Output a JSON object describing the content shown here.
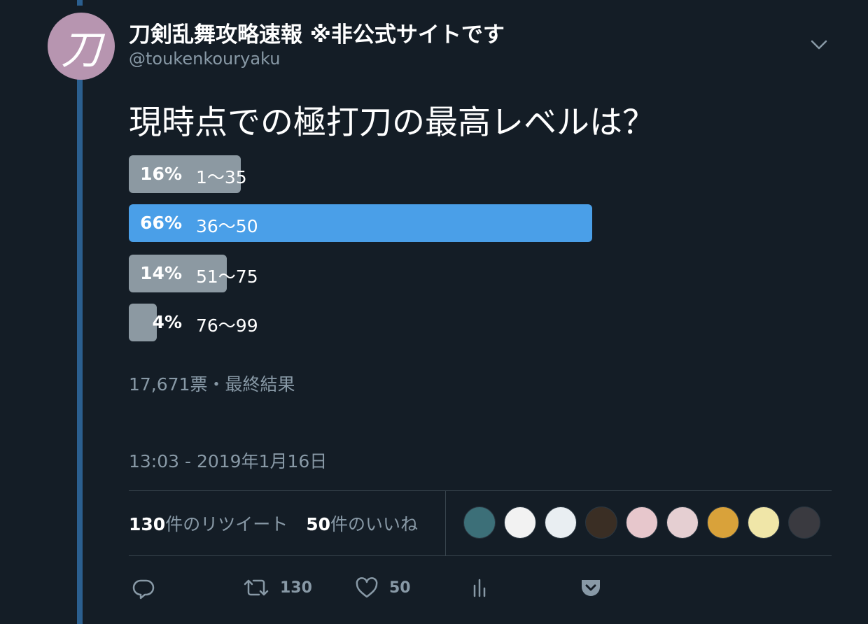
{
  "tweet": {
    "author_name": "刀剣乱舞攻略速報 ※非公式サイトです",
    "handle": "@toukenkouryaku",
    "avatar_glyph": "刀",
    "avatar_color": "#b795b0",
    "question": "現時点での極打刀の最高レベルは？"
  },
  "poll": {
    "options": [
      {
        "percent": "16%",
        "label": "1〜35",
        "share": 16
      },
      {
        "percent": "66%",
        "label": "36〜50",
        "share": 66,
        "winner": true
      },
      {
        "percent": "14%",
        "label": "51〜75",
        "share": 14
      },
      {
        "percent": "4%",
        "label": "76〜99",
        "share": 4
      }
    ],
    "votes_summary": "17,671票・最終結果",
    "winner_color": "#4a9fe8",
    "other_color": "#8c99a2"
  },
  "timestamp": "13:03 - 2019年1月16日",
  "stats": {
    "retweets_count": "130",
    "retweets_label": "件のリツイート",
    "likes_count": "50",
    "likes_label": "件のいいね"
  },
  "liked_by": [
    {
      "name": "liker-avatar-1",
      "color": "#3c6f78"
    },
    {
      "name": "liker-avatar-2",
      "color": "#f2f2f2"
    },
    {
      "name": "liker-avatar-3",
      "color": "#e9eef2"
    },
    {
      "name": "liker-avatar-4",
      "color": "#3a2e24"
    },
    {
      "name": "liker-avatar-5",
      "color": "#e7c7cc"
    },
    {
      "name": "liker-avatar-6",
      "color": "#e5cfd2"
    },
    {
      "name": "liker-avatar-7",
      "color": "#d9a23a"
    },
    {
      "name": "liker-avatar-8",
      "color": "#f0e6a8"
    },
    {
      "name": "liker-avatar-9",
      "color": "#3a3a40"
    }
  ],
  "actions": {
    "reply_icon": "reply-icon",
    "retweet_icon": "retweet-icon",
    "retweet_count": "130",
    "like_icon": "heart-icon",
    "like_count": "50",
    "analytics_icon": "analytics-icon",
    "pocket_icon": "pocket-icon"
  }
}
